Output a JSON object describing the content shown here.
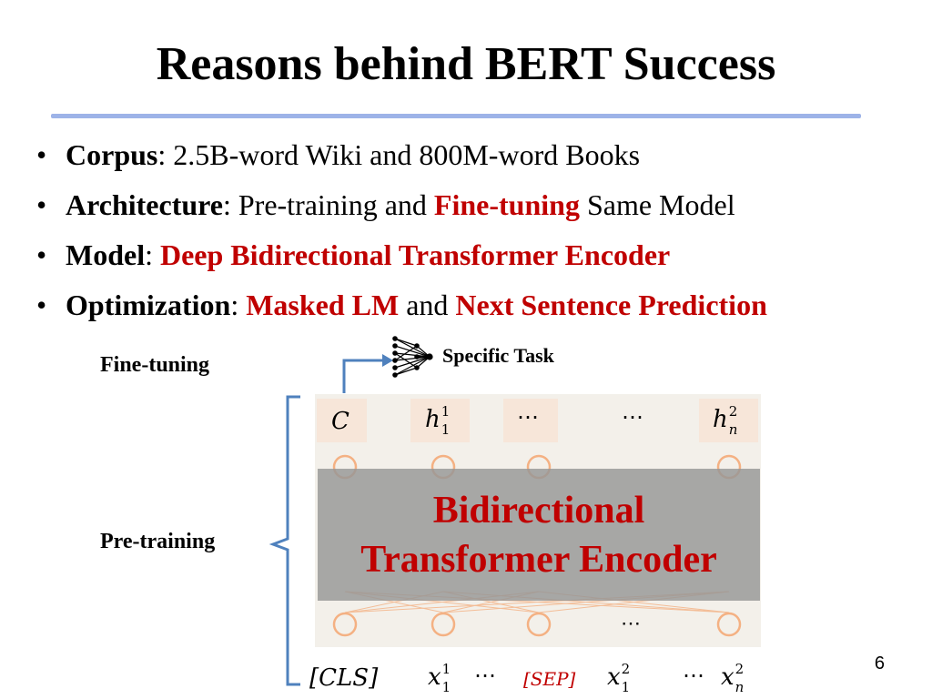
{
  "slide": {
    "title": "Reasons behind BERT Success",
    "page_number": "6"
  },
  "bullets": [
    {
      "head": "Corpus",
      "sep": ": ",
      "parts": [
        {
          "text": "2.5B-word Wiki and 800M-word Books",
          "style": "normal"
        }
      ]
    },
    {
      "head": "Architecture",
      "sep": ": ",
      "parts": [
        {
          "text": "Pre-training and ",
          "style": "normal"
        },
        {
          "text": "Fine-tuning",
          "style": "red"
        },
        {
          "text": " Same Model",
          "style": "normal"
        }
      ]
    },
    {
      "head": "Model",
      "sep": ": ",
      "parts": [
        {
          "text": "Deep Bidirectional Transformer Encoder",
          "style": "red"
        }
      ]
    },
    {
      "head": "Optimization",
      "sep": ": ",
      "parts": [
        {
          "text": "Masked LM",
          "style": "red"
        },
        {
          "text": " and ",
          "style": "normal"
        },
        {
          "text": "Next Sentence Prediction",
          "style": "red"
        }
      ]
    }
  ],
  "diagram": {
    "fine_tuning_label": "Fine-tuning",
    "pre_training_label": "Pre-training",
    "specific_task_label": "Specific Task",
    "encoder_line1": "Bidirectional",
    "encoder_line2": "Transformer Encoder",
    "outputs": {
      "c": "C",
      "h1": "h",
      "h1_sup": "1",
      "h1_sub": "1",
      "dots1": "⋯",
      "dots2": "⋯",
      "hn": "h",
      "hn_sup": "2",
      "hn_sub": "n"
    },
    "inputs": {
      "cls": "[CLS]",
      "x1": "x",
      "x1_sup": "1",
      "x1_sub": "1",
      "dots1": "⋯",
      "sep": "[SEP]",
      "x2": "x",
      "x2_sup": "2",
      "x2_sub": "1",
      "dots2": "⋯",
      "xn": "x",
      "xn_sup": "2",
      "xn_sub": "n"
    },
    "mid_dots": "⋯"
  },
  "colors": {
    "accent_red": "#c00000",
    "rule_blue": "#9db3e8",
    "bracket_blue": "#4f81bd",
    "panel_bg": "#f3f0ea",
    "cell_bg": "#f7e6d9",
    "node_orange": "#f4b183",
    "encoder_gray": "#969696"
  }
}
